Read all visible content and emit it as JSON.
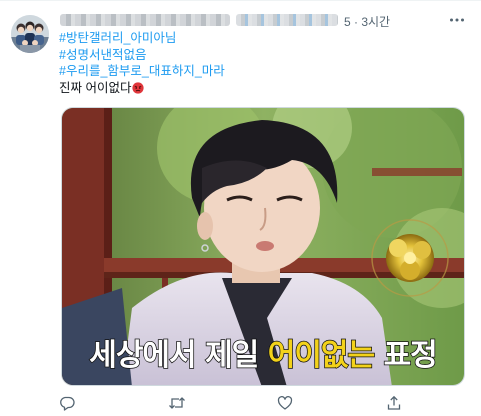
{
  "tweet": {
    "time_label": "5 · 3시간",
    "lines": [
      {
        "text": "#방탄갤러리_아미아님",
        "kind": "hashtag"
      },
      {
        "text": "#성명서낸적없음",
        "kind": "hashtag"
      },
      {
        "text": "#우리를_함부로_대표하지_마라",
        "kind": "hashtag"
      },
      {
        "text": "진짜 어이없다",
        "kind": "text"
      }
    ],
    "line_end_emoji": "angry-face-icon"
  },
  "media": {
    "caption_white_1": "세상에서 제일 ",
    "caption_yellow": "어이없는",
    "caption_white_2": " 표정"
  },
  "icons": {
    "more": "more-options-icon",
    "reply": "reply-icon",
    "retweet": "retweet-icon",
    "like": "like-icon",
    "share": "share-icon"
  },
  "colors": {
    "hashtag": "#1d9bf0",
    "text": "#0f1419",
    "meta": "#536471",
    "caption_highlight": "#f3d21a"
  }
}
